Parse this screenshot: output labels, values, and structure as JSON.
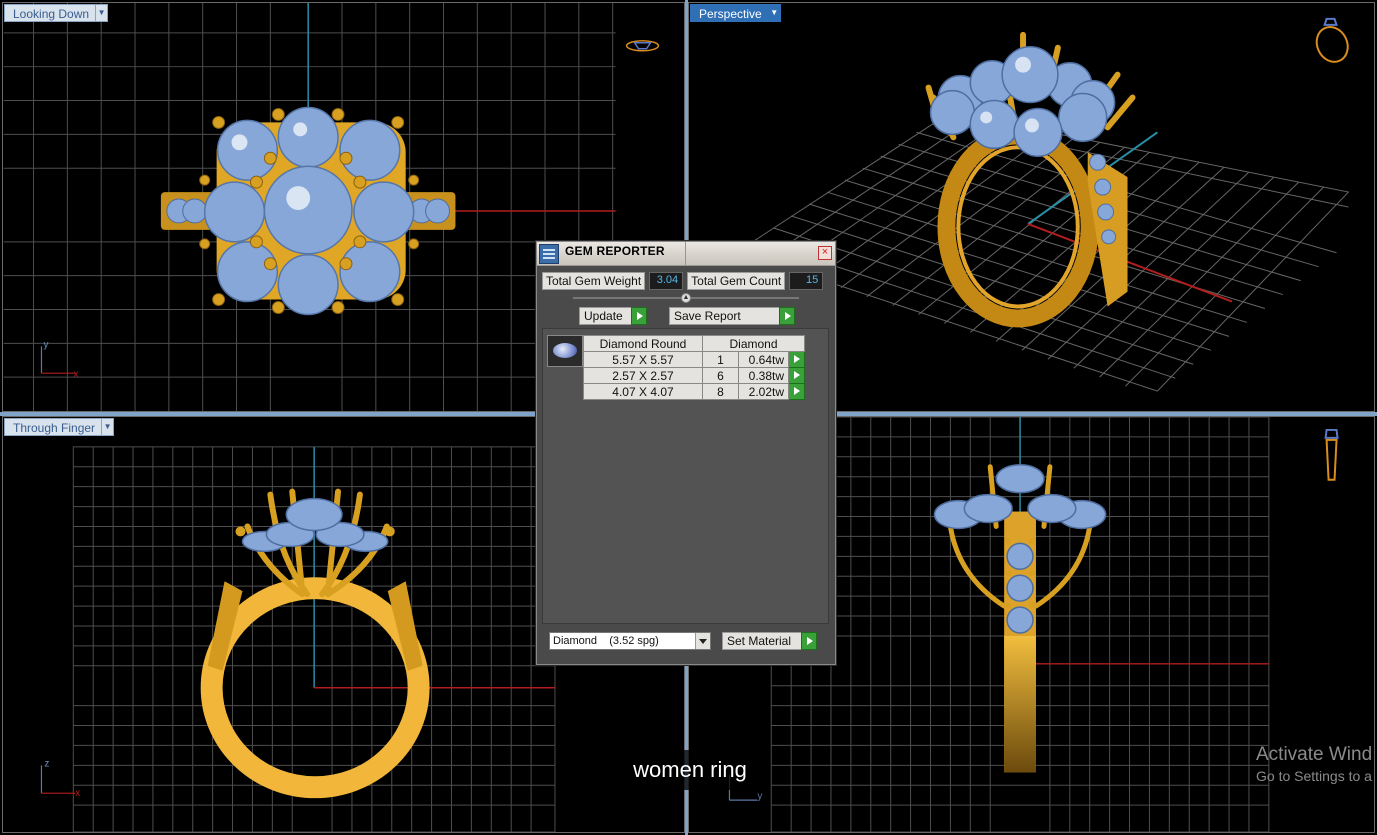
{
  "viewports": {
    "top_left": {
      "label": "Looking Down",
      "axis": [
        "y",
        "x"
      ]
    },
    "top_right": {
      "label": "Perspective"
    },
    "bottom_left": {
      "label": "Through Finger",
      "axis": [
        "z",
        "x"
      ]
    },
    "bottom_right": {
      "label": "",
      "axis": [
        "y"
      ]
    }
  },
  "gem_reporter": {
    "title": "GEM REPORTER",
    "close": "×",
    "total_weight_label": "Total Gem Weight",
    "total_weight_value": "3.04",
    "total_count_label": "Total Gem Count",
    "total_count_value": "15",
    "update_label": "Update",
    "save_report_label": "Save Report",
    "table": {
      "headers": [
        "Diamond Round",
        "Diamond"
      ],
      "rows": [
        {
          "size": "5.57 X 5.57",
          "count": "1",
          "weight": "0.64tw"
        },
        {
          "size": "2.57 X 2.57",
          "count": "6",
          "weight": "0.38tw"
        },
        {
          "size": "4.07 X 4.07",
          "count": "8",
          "weight": "2.02tw"
        }
      ]
    },
    "material_select": "Diamond    (3.52 spg)",
    "set_material_label": "Set Material"
  },
  "caption": "women ring",
  "watermark": {
    "line1": "Activate Wind",
    "line2": "Go to Settings to a"
  },
  "colors": {
    "grid": "#5a5a5a",
    "gold": "#e0a626",
    "gem": "#86a7d8",
    "axis_red": "#b21d1d",
    "axis_cyan": "#2a8fa8",
    "divider": "#7fa3c9"
  }
}
